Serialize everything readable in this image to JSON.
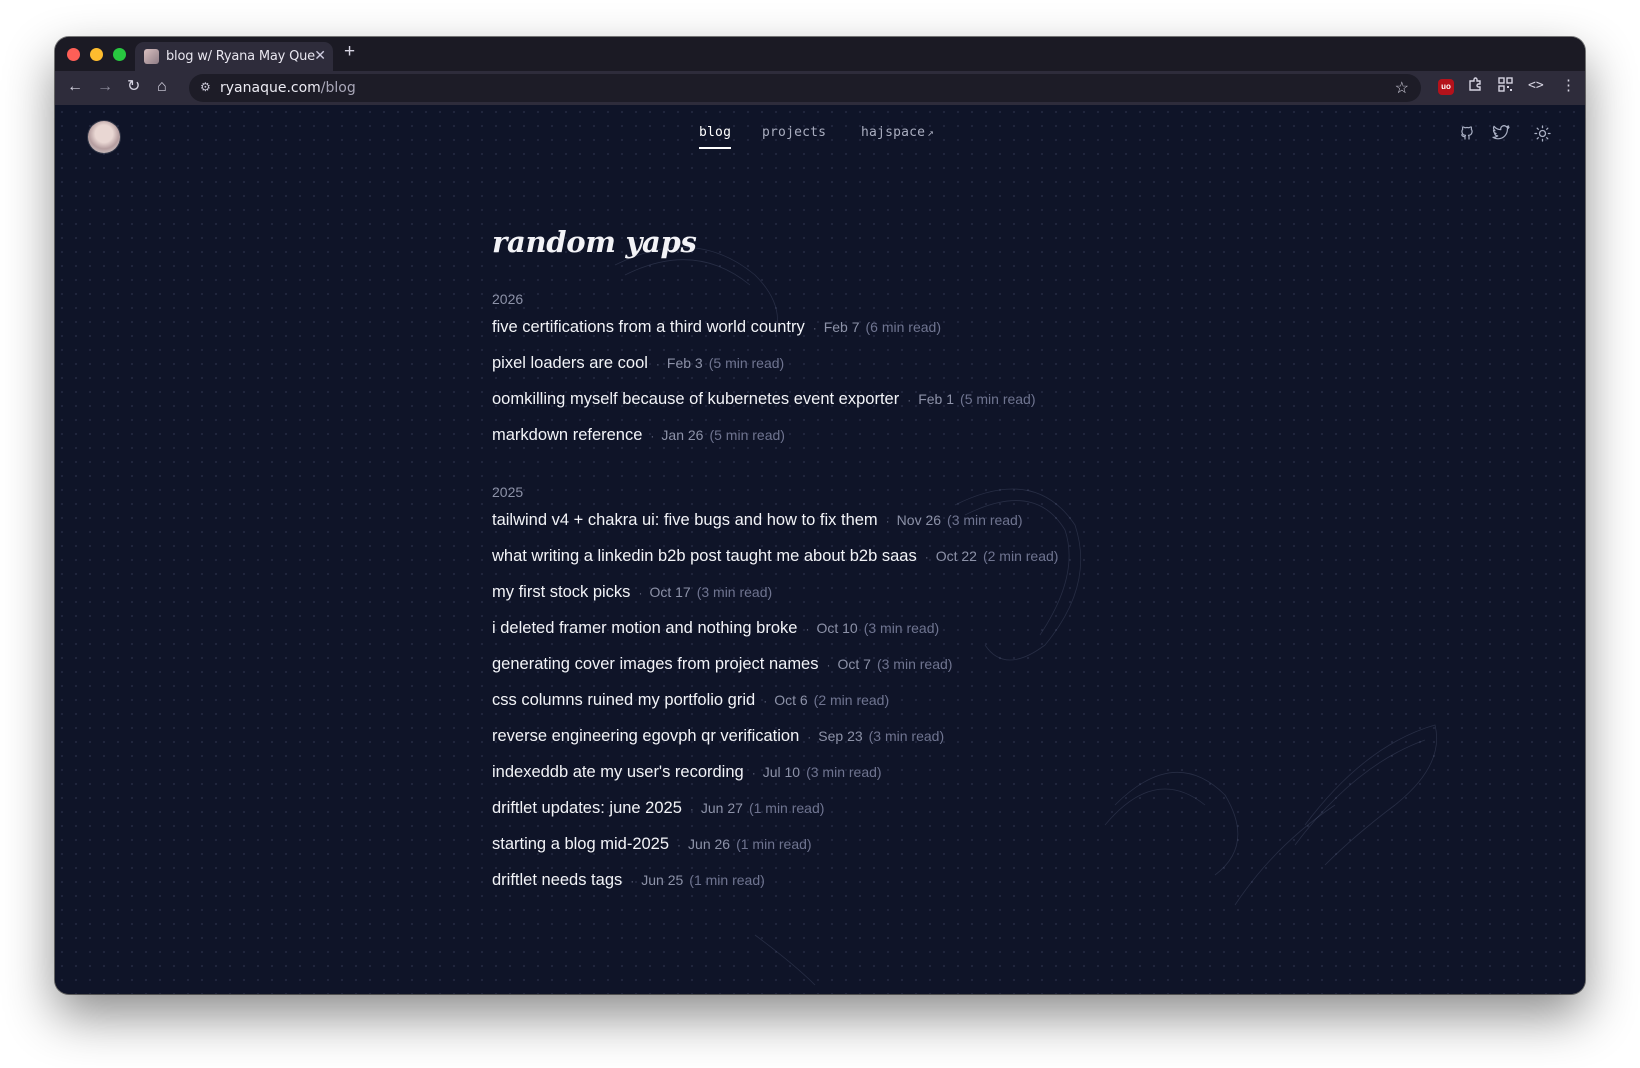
{
  "browser": {
    "tab_title": "blog w/ Ryana May Que",
    "tab_close": "✕",
    "new_tab": "+",
    "url_host": "ryanaque.com",
    "url_path": "/blog",
    "icons": [
      "back-icon",
      "forward-icon",
      "reload-icon",
      "home-icon",
      "site-info-icon",
      "star-icon",
      "ublock-icon",
      "extensions-icon",
      "qr-icon",
      "devtools-icon",
      "menu-icon"
    ]
  },
  "nav": {
    "links": [
      {
        "label": "blog",
        "active": true
      },
      {
        "label": "projects",
        "active": false
      },
      {
        "label": "hajspace",
        "active": false,
        "external": true
      }
    ],
    "icons": [
      "github-icon",
      "twitter-icon",
      "theme-toggle-icon"
    ]
  },
  "page": {
    "title": "random yaps",
    "sections": [
      {
        "year": "2026",
        "posts": [
          {
            "title": "five certifications from a third world country",
            "date": "Feb 7",
            "read": "(6 min read)"
          },
          {
            "title": "pixel loaders are cool",
            "date": "Feb 3",
            "read": "(5 min read)"
          },
          {
            "title": "oomkilling myself because of kubernetes event exporter",
            "date": "Feb 1",
            "read": "(5 min read)"
          },
          {
            "title": "markdown reference",
            "date": "Jan 26",
            "read": "(5 min read)"
          }
        ]
      },
      {
        "year": "2025",
        "posts": [
          {
            "title": "tailwind v4 + chakra ui: five bugs and how to fix them",
            "date": "Nov 26",
            "read": "(3 min read)"
          },
          {
            "title": "what writing a linkedin b2b post taught me about b2b saas",
            "date": "Oct 22",
            "read": "(2 min read)"
          },
          {
            "title": "my first stock picks",
            "date": "Oct 17",
            "read": "(3 min read)"
          },
          {
            "title": "i deleted framer motion and nothing broke",
            "date": "Oct 10",
            "read": "(3 min read)"
          },
          {
            "title": "generating cover images from project names",
            "date": "Oct 7",
            "read": "(3 min read)"
          },
          {
            "title": "css columns ruined my portfolio grid",
            "date": "Oct 6",
            "read": "(2 min read)"
          },
          {
            "title": "reverse engineering egovph qr verification",
            "date": "Sep 23",
            "read": "(3 min read)"
          },
          {
            "title": "indexeddb ate my user's recording",
            "date": "Jul 10",
            "read": "(3 min read)"
          },
          {
            "title": "driftlet updates: june 2025",
            "date": "Jun 27",
            "read": "(1 min read)"
          },
          {
            "title": "starting a blog mid-2025",
            "date": "Jun 26",
            "read": "(1 min read)"
          },
          {
            "title": "driftlet needs tags",
            "date": "Jun 25",
            "read": "(1 min read)"
          }
        ]
      }
    ]
  },
  "colors": {
    "page_bg": "#0f1428",
    "text": "#f2f3f7",
    "muted": "#8d92a8",
    "chrome": "#2e2c3b"
  }
}
